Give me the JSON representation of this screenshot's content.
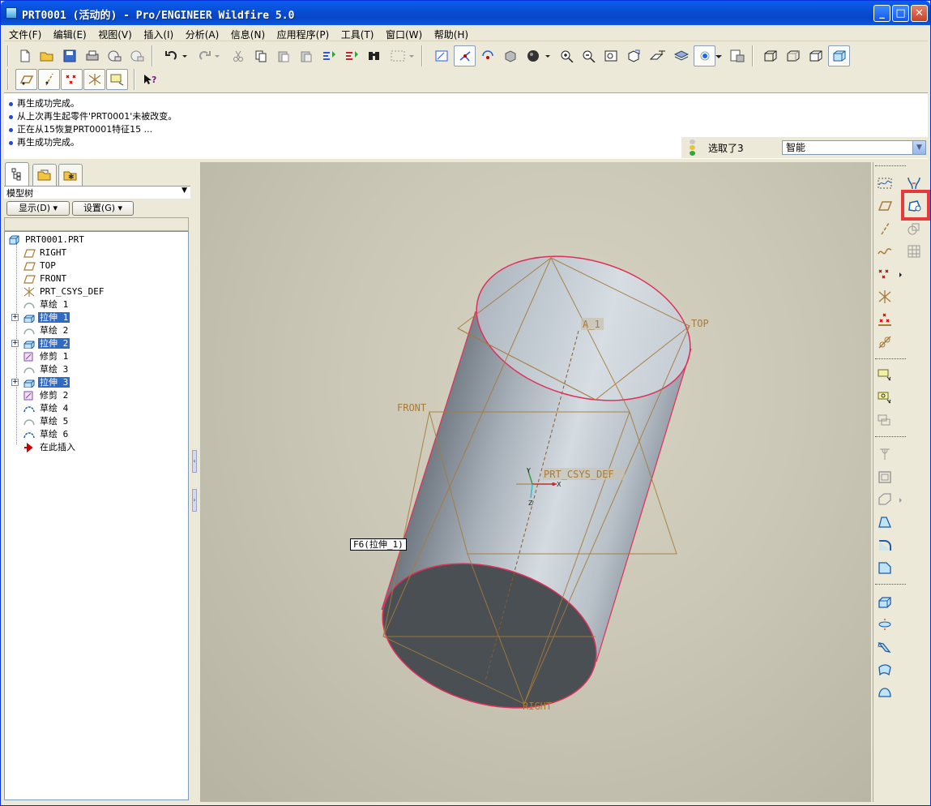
{
  "window": {
    "title": "PRT0001 (活动的) - Pro/ENGINEER Wildfire 5.0"
  },
  "menu": [
    "文件(F)",
    "编辑(E)",
    "视图(V)",
    "插入(I)",
    "分析(A)",
    "信息(N)",
    "应用程序(P)",
    "工具(T)",
    "窗口(W)",
    "帮助(H)"
  ],
  "messages": [
    "再生成功完成。",
    "从上次再生起零件'PRT0001'未被改变。",
    "正在从15恢复PRT0001特征15 ...",
    "再生成功完成。"
  ],
  "status": {
    "selected_text": "选取了3",
    "filter_value": "智能"
  },
  "left_pane": {
    "tree_header": "模型树",
    "show_button": "显示(D) ▾",
    "settings_button": "设置(G) ▾"
  },
  "tree": [
    {
      "label": "PRT0001.PRT",
      "icon": "part-icon",
      "level": 0,
      "selected": false,
      "expander": false
    },
    {
      "label": "RIGHT",
      "icon": "datum-plane-icon",
      "level": 1,
      "selected": false,
      "expander": false
    },
    {
      "label": "TOP",
      "icon": "datum-plane-icon",
      "level": 1,
      "selected": false,
      "expander": false
    },
    {
      "label": "FRONT",
      "icon": "datum-plane-icon",
      "level": 1,
      "selected": false,
      "expander": false
    },
    {
      "label": "PRT_CSYS_DEF",
      "icon": "csys-icon",
      "level": 1,
      "selected": false,
      "expander": false
    },
    {
      "label": "草绘 1",
      "icon": "sketch-icon",
      "level": 1,
      "selected": false,
      "expander": false
    },
    {
      "label": "拉伸 1",
      "icon": "extrude-icon",
      "level": 1,
      "selected": true,
      "expander": true
    },
    {
      "label": "草绘 2",
      "icon": "sketch-icon",
      "level": 1,
      "selected": false,
      "expander": false
    },
    {
      "label": "拉伸 2",
      "icon": "extrude-icon",
      "level": 1,
      "selected": true,
      "expander": true
    },
    {
      "label": "修剪 1",
      "icon": "trim-icon",
      "level": 1,
      "selected": false,
      "expander": false
    },
    {
      "label": "草绘 3",
      "icon": "sketch-icon",
      "level": 1,
      "selected": false,
      "expander": false
    },
    {
      "label": "拉伸 3",
      "icon": "extrude-icon",
      "level": 1,
      "selected": true,
      "expander": true
    },
    {
      "label": "修剪 2",
      "icon": "trim-icon",
      "level": 1,
      "selected": false,
      "expander": false
    },
    {
      "label": "草绘 4",
      "icon": "sketch-icon",
      "level": 1,
      "selected": false,
      "expander": false
    },
    {
      "label": "草绘 5",
      "icon": "sketch-icon",
      "level": 1,
      "selected": false,
      "expander": false
    },
    {
      "label": "草绘 6",
      "icon": "sketch-icon",
      "level": 1,
      "selected": false,
      "expander": false
    },
    {
      "label": "在此插入",
      "icon": "insert-here-icon",
      "level": 1,
      "selected": false,
      "expander": false
    }
  ],
  "viewport": {
    "labels": {
      "top": "TOP",
      "front": "FRONT",
      "right": "RIGHT",
      "axis": "A_1",
      "csys": "PRT_CSYS_DEF",
      "csys_x": "X",
      "csys_y": "Y",
      "csys_z": "Z"
    },
    "tooltip": "F6(拉伸_1)"
  },
  "colors": {
    "titlebar": "#0a4fd6",
    "selection": "#316ac5",
    "edge_highlight": "#e0305a",
    "datum": "#a77b3a",
    "highlight_box": "#e8393a"
  }
}
